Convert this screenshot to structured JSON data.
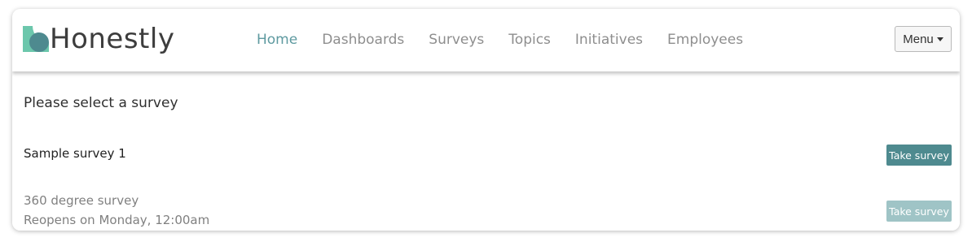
{
  "brand": {
    "name": "Honestly",
    "accent": "#5e9aa0",
    "logo_colors": [
      "#6cc7ac",
      "#4e8a8f"
    ]
  },
  "nav": {
    "items": [
      {
        "label": "Home",
        "active": true
      },
      {
        "label": "Dashboards",
        "active": false
      },
      {
        "label": "Surveys",
        "active": false
      },
      {
        "label": "Topics",
        "active": false
      },
      {
        "label": "Initiatives",
        "active": false
      },
      {
        "label": "Employees",
        "active": false
      }
    ],
    "menu_label": "Menu"
  },
  "main": {
    "heading": "Please select a survey",
    "surveys": [
      {
        "name": "Sample survey 1",
        "note": "",
        "button": "Take survey",
        "enabled": true
      },
      {
        "name": "360 degree survey",
        "note": "Reopens on Monday, 12:00am",
        "button": "Take survey",
        "enabled": false
      }
    ]
  }
}
